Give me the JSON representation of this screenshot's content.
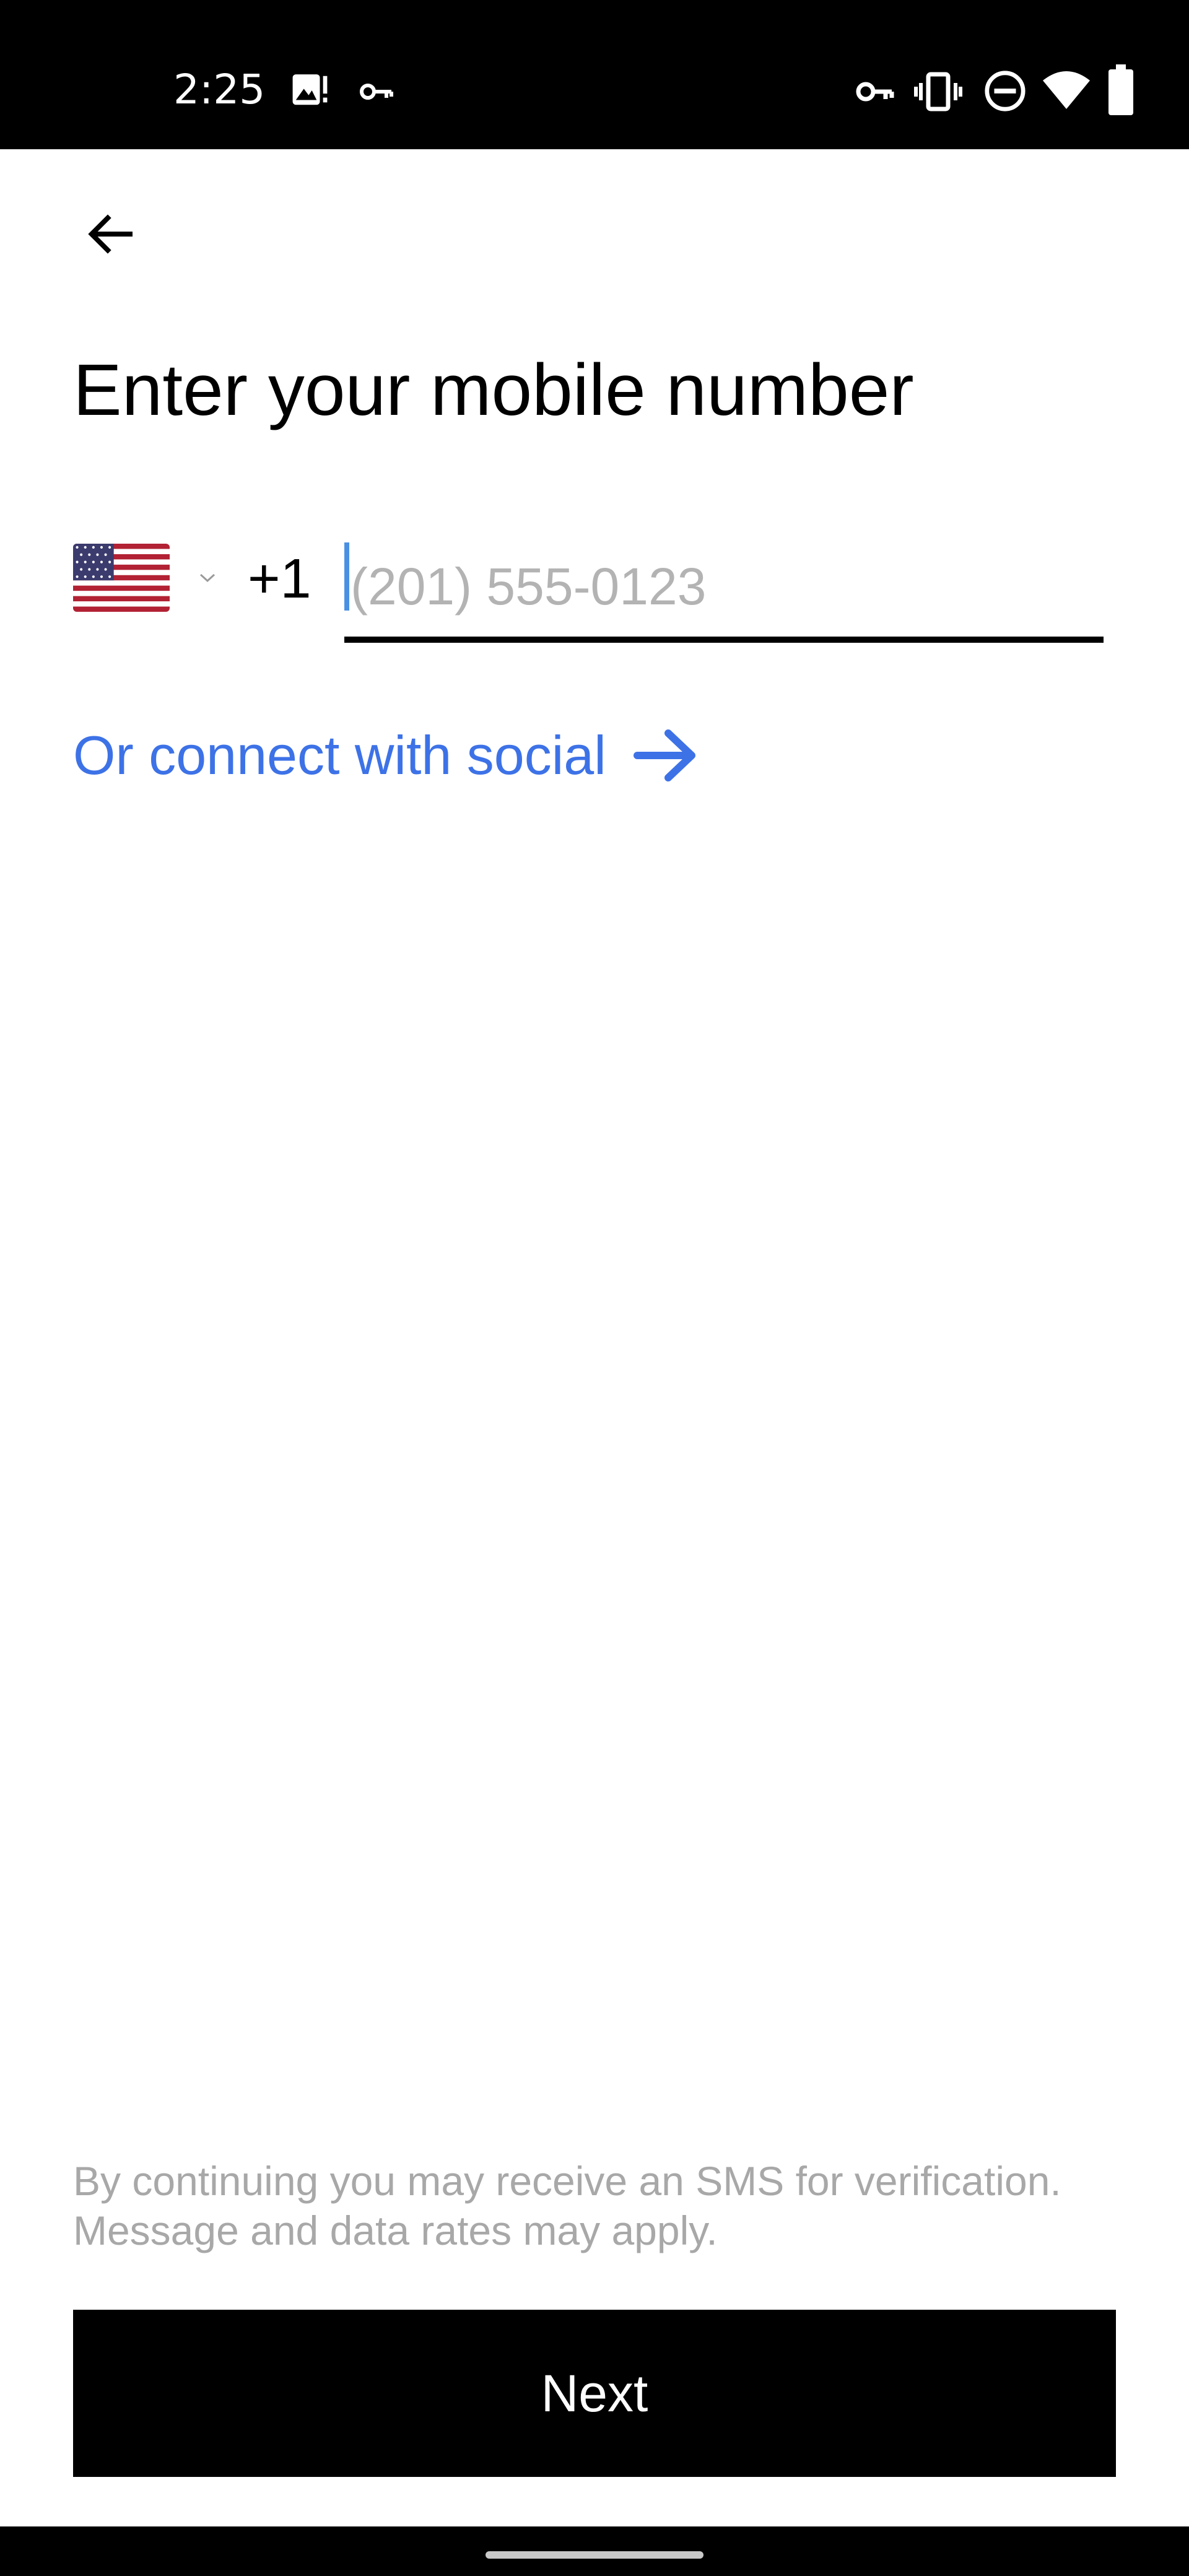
{
  "status_bar": {
    "time": "2:25",
    "icons": [
      "gallery-notification-icon",
      "vpn-key-icon",
      "vpn-key-icon",
      "vibrate-icon",
      "do-not-disturb-icon",
      "wifi-icon",
      "battery-icon"
    ]
  },
  "header": {
    "back_icon": "back-arrow-icon",
    "title": "Enter your mobile number"
  },
  "phone": {
    "country_flag": "us-flag-icon",
    "country_code": "+1",
    "value": "",
    "placeholder": "(201) 555-0123"
  },
  "social": {
    "label": "Or connect with social",
    "icon": "arrow-right-icon"
  },
  "footer": {
    "disclaimer": "By continuing you may receive an SMS for verification. Message and data rates may apply.",
    "next_label": "Next"
  },
  "colors": {
    "accent_link": "#3d72e7",
    "cursor": "#4a90e2",
    "placeholder": "#b3b3b3",
    "disclaimer": "#a8a8a8",
    "button_bg": "#000000",
    "button_text": "#ffffff"
  }
}
